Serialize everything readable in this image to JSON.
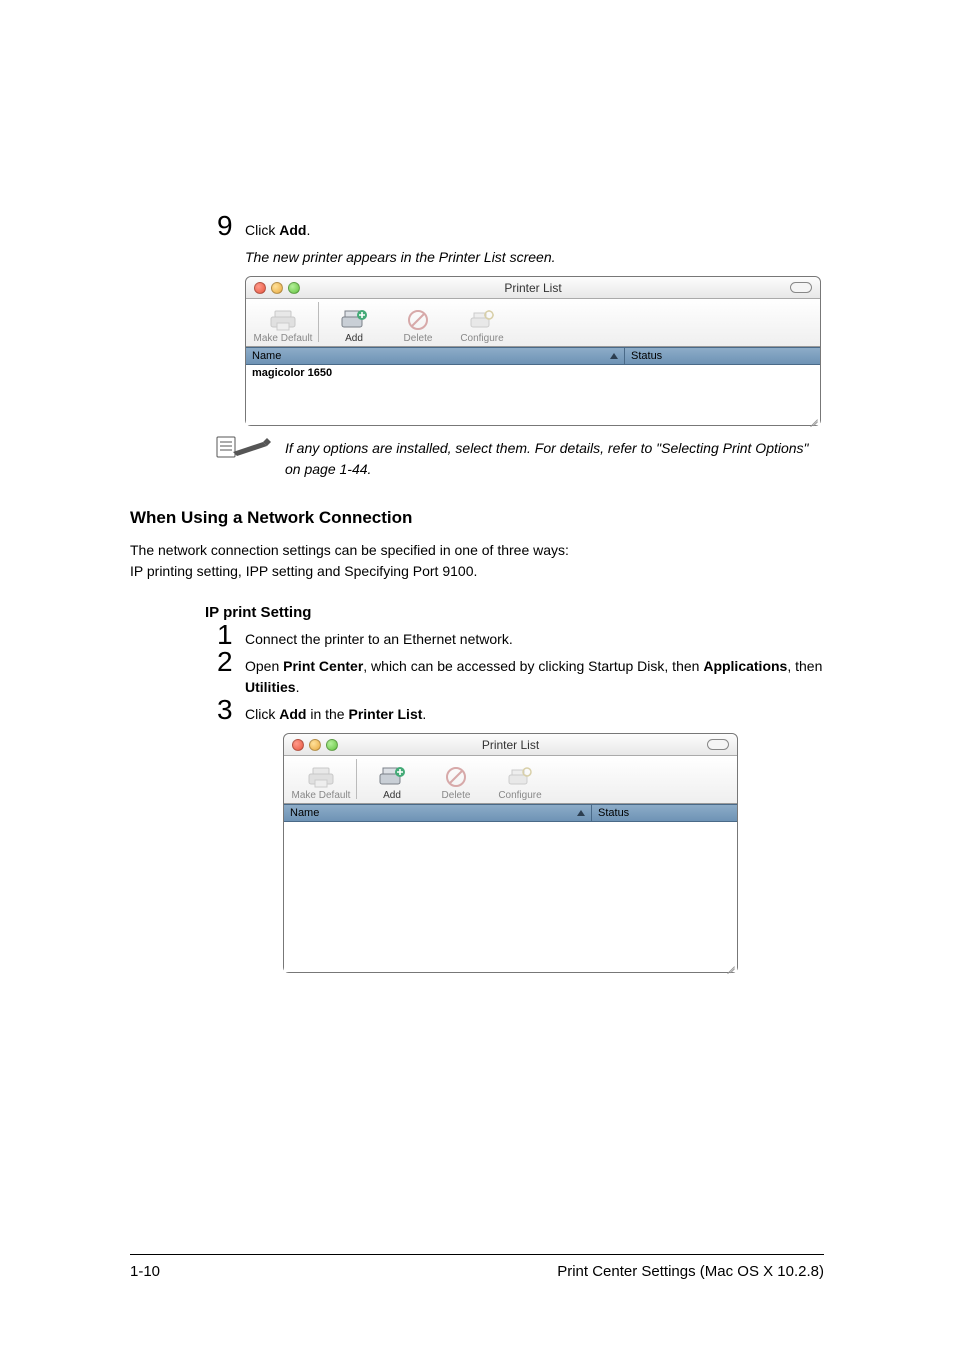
{
  "step9": {
    "num": "9",
    "text_pre": "Click ",
    "text_bold": "Add",
    "text_post": ".",
    "result": "The new printer appears in the Printer List screen."
  },
  "note": {
    "text": "If any options are installed, select them. For details, refer to \"Selecting Print Options\" on page 1-44."
  },
  "section": {
    "title": "When Using a Network Connection",
    "body1": "The network connection settings can be specified in one of three ways:",
    "body2": "IP printing setting, IPP setting and Specifying Port 9100.",
    "sub": "IP print Setting"
  },
  "steps": [
    {
      "num": "1",
      "parts": [
        {
          "t": "Connect the printer to an Ethernet network."
        }
      ]
    },
    {
      "num": "2",
      "parts": [
        {
          "t": "Open "
        },
        {
          "b": "Print Center"
        },
        {
          "t": ", which can be accessed by clicking Startup Disk, then "
        },
        {
          "b": "Applications"
        },
        {
          "t": ", then "
        },
        {
          "b": "Utilities"
        },
        {
          "t": "."
        }
      ]
    },
    {
      "num": "3",
      "parts": [
        {
          "t": "Click "
        },
        {
          "b": "Add"
        },
        {
          "t": " in the "
        },
        {
          "b": "Printer List"
        },
        {
          "t": "."
        }
      ]
    }
  ],
  "window": {
    "title": "Printer List",
    "toolbar": {
      "make_default": "Make Default",
      "add": "Add",
      "delete": "Delete",
      "configure": "Configure"
    },
    "columns": {
      "name": "Name",
      "status": "Status"
    },
    "row1": "magicolor 1650"
  },
  "footer": {
    "page": "1-10",
    "title": "Print Center Settings (Mac OS X 10.2.8)"
  }
}
